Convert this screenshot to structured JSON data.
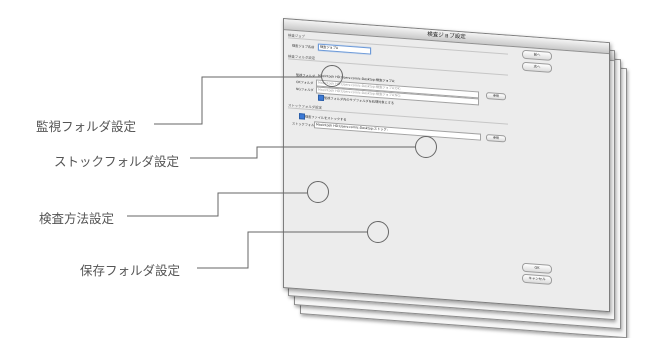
{
  "back_window": {
    "title": "検査ジョブ設定"
  },
  "window": {
    "title": "検査ジョブ設定",
    "job_section": "検査ジョブ",
    "job_name_label": "検査ジョブ名前",
    "job_name_value": "検査ジョブA",
    "monitor_section": "検査フォルダ設定",
    "monitor_folder_label": "監視フォルダ",
    "monitor_folder_value": "Macintosh HD:Users:comic:Desktop:検査ジョブA:",
    "ok_folder_label": "OKフォルダ",
    "ok_folder_value": "Macintosh HD:Users:comic:Desktop:検査ジョブA:OK:",
    "ng_folder_label": "NGフォルダ",
    "ng_folder_value": "Macintosh HD:Users:comic:Desktop:検査ジョブA:NG:",
    "subfolder_check_label": "監視フォルダ内のサブフォルダを処理対象とする",
    "browse_label": "参照",
    "stock_section": "ストックフォルダ設定",
    "stock_check_label": "検査ファイルをストックする",
    "stock_folder_label": "ストックフォルダ",
    "stock_folder_value": "Macintosh HD:Users:comic:Desktop:ストック:",
    "stock_browse_label": "参照",
    "prev_button": "前へ",
    "next_button": "次へ",
    "ok_button": "OK",
    "cancel_button": "キャンセル"
  },
  "callouts": {
    "monitor": "監視フォルダ設定",
    "stock": "ストックフォルダ設定",
    "inspection": "検査方法設定",
    "save": "保存フォルダ設定"
  }
}
